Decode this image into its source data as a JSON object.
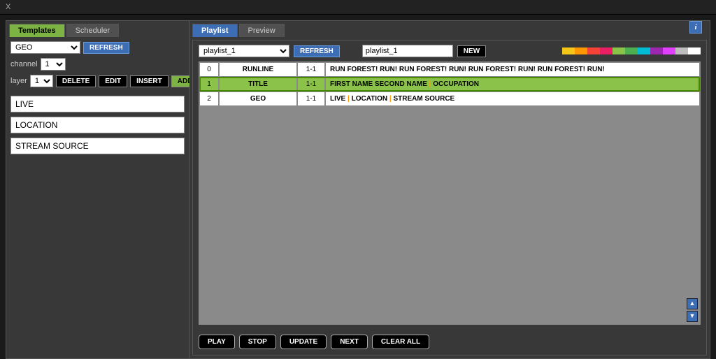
{
  "window": {
    "title": "X"
  },
  "left": {
    "tabs": [
      {
        "label": "Templates",
        "active": true
      },
      {
        "label": "Scheduler",
        "active": false
      }
    ],
    "template_select": "GEO",
    "refresh": "REFRESH",
    "channel_label": "channel",
    "channel_value": "1",
    "layer_label": "layer",
    "layer_value": "1",
    "buttons": {
      "delete": "DELETE",
      "edit": "EDIT",
      "insert": "INSERT",
      "add": "ADD"
    },
    "fields": [
      "LIVE",
      "LOCATION",
      "STREAM SOURCE"
    ]
  },
  "right": {
    "tabs": [
      {
        "label": "Playlist",
        "active": true
      },
      {
        "label": "Preview",
        "active": false
      }
    ],
    "playlist_select": "playlist_1",
    "refresh": "REFRESH",
    "playlist_name": "playlist_1",
    "new_btn": "NEW",
    "swatches": [
      "#f5c518",
      "#ff9800",
      "#f44336",
      "#e91e63",
      "#8bc34a",
      "#4caf50",
      "#00bcd4",
      "#9c27b0",
      "#e040fb",
      "#bdbdbd",
      "#ffffff"
    ],
    "rows": [
      {
        "idx": "0",
        "type": "RUNLINE",
        "ch": "1-1",
        "content": "RUN FOREST! RUN! RUN FOREST! RUN! RUN FOREST! RUN! RUN FOREST! RUN!",
        "selected": false
      },
      {
        "idx": "1",
        "type": "TITLE",
        "ch": "1-1",
        "parts": [
          "FIRST NAME SECOND NAME",
          "OCCUPATION"
        ],
        "selected": true
      },
      {
        "idx": "2",
        "type": "GEO",
        "ch": "1-1",
        "parts": [
          "LIVE",
          "LOCATION",
          "STREAM SOURCE"
        ],
        "selected": false
      }
    ],
    "buttons": {
      "play": "PLAY",
      "stop": "STOP",
      "update": "UPDATE",
      "next": "NEXT",
      "clear": "CLEAR ALL"
    },
    "info": "i"
  }
}
